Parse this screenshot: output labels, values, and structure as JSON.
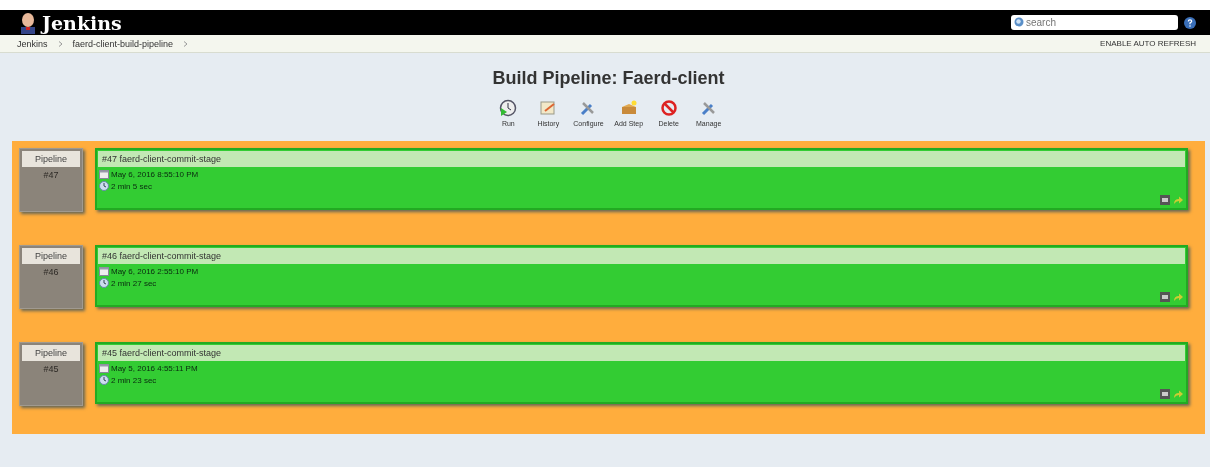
{
  "header": {
    "logo": "Jenkins",
    "search": {
      "placeholder": "search"
    }
  },
  "breadcrumbs": [
    "Jenkins",
    "faerd-client-build-pipeline"
  ],
  "auto_refresh": "ENABLE AUTO REFRESH",
  "title": "Build Pipeline: Faerd-client",
  "actions": [
    {
      "kind": "run",
      "label": "Run"
    },
    {
      "kind": "history",
      "label": "History"
    },
    {
      "kind": "configure",
      "label": "Configure"
    },
    {
      "kind": "add",
      "label": "Add Step"
    },
    {
      "kind": "delete",
      "label": "Delete"
    },
    {
      "kind": "manage",
      "label": "Manage"
    }
  ],
  "pipelines": [
    {
      "label": "Pipeline",
      "number": "#47",
      "build": {
        "name": "#47 faerd-client-commit-stage",
        "date": "May 6, 2016 8:55:10 PM",
        "duration": "2 min 5 sec",
        "kind": "success"
      }
    },
    {
      "label": "Pipeline",
      "number": "#46",
      "build": {
        "name": "#46 faerd-client-commit-stage",
        "date": "May 6, 2016 2:55:10 PM",
        "duration": "2 min 27 sec",
        "kind": "success"
      }
    },
    {
      "label": "Pipeline",
      "number": "#45",
      "build": {
        "name": "#45 faerd-client-commit-stage",
        "date": "May 5, 2016 4:55:11 PM",
        "duration": "2 min 23 sec",
        "kind": "success"
      }
    }
  ]
}
